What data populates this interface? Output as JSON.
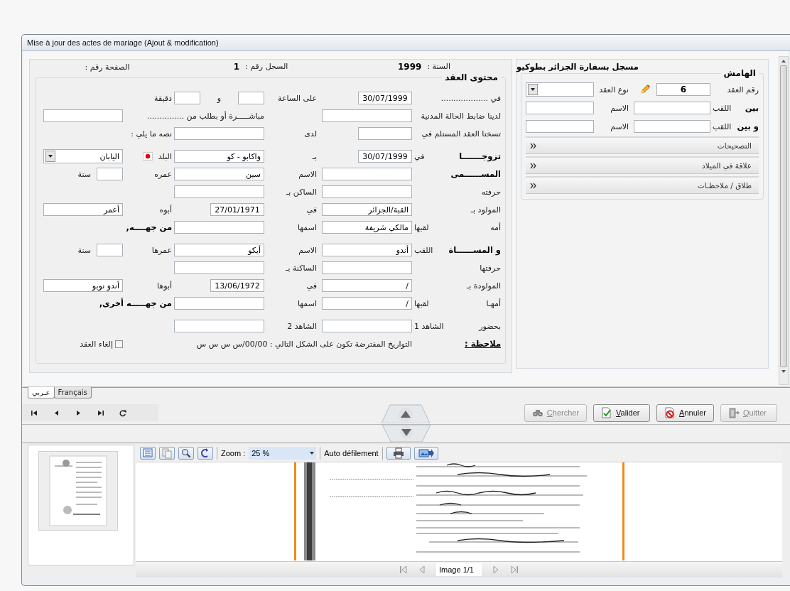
{
  "window": {
    "title": "Mise à jour des actes de mariage (Ajout & modification)"
  },
  "header": {
    "year_label": "السنة :",
    "year_value": "1999",
    "register_label": "السجل رقم :",
    "register_value": "1",
    "page_label": "الصفحة رقم :"
  },
  "contract": {
    "legend": "محتوى العقد",
    "sections": [
      [
        {
          "label_a": [
            {
              "kind": "label",
              "text": "في ..................."
            }
          ],
          "field_a": [
            {
              "kind": "short_field",
              "value": "30/07/1999"
            }
          ],
          "label_b": [
            {
              "kind": "label",
              "text": "على الساعة"
            }
          ],
          "field_b": [
            {
              "kind": "tiny_field"
            },
            {
              "kind": "label",
              "text": "و"
            },
            {
              "kind": "tiny_field"
            }
          ],
          "label_c": [
            {
              "kind": "label",
              "text": "دقيقة"
            }
          ]
        },
        {
          "label_a": [
            {
              "kind": "label",
              "text": "لدينا ضابط الحالة المدنية"
            }
          ],
          "field_a": [
            {
              "kind": "field"
            }
          ],
          "label_bc": [
            {
              "kind": "label",
              "text": "مباشـــــرة أو بطلب من ..............."
            }
          ],
          "field_c": [
            {
              "kind": "field"
            }
          ]
        },
        {
          "label_a": [
            {
              "kind": "label",
              "text": "تسختا العقد المستلم في"
            }
          ],
          "field_a": [
            {
              "kind": "short_field"
            }
          ],
          "label_b": [
            {
              "kind": "label",
              "text": "لدى"
            }
          ],
          "field_b": [
            {
              "kind": "field"
            }
          ],
          "label_c": [
            {
              "kind": "label",
              "text": "نصه ما يلي :"
            }
          ]
        }
      ],
      [
        {
          "label_a": [
            {
              "kind": "bold",
              "text": "تزوجـــــــا"
            },
            {
              "kind": "label",
              "text": "في"
            }
          ],
          "field_a": [
            {
              "kind": "short_field",
              "value": "30/07/1999"
            }
          ],
          "label_b": [
            {
              "kind": "label",
              "text": "بـ"
            }
          ],
          "field_b": [
            {
              "kind": "field",
              "value": "واكابو - كو"
            }
          ],
          "label_c": [
            {
              "kind": "label",
              "text": "البلد"
            },
            {
              "kind": "flag"
            }
          ],
          "field_c": [
            {
              "kind": "select",
              "value": "اليابان"
            }
          ]
        },
        {
          "label_a": [
            {
              "kind": "bold",
              "text": "المســــــمى"
            }
          ],
          "field_a": [
            {
              "kind": "field"
            }
          ],
          "label_b": [
            {
              "kind": "label",
              "text": "الاسم"
            }
          ],
          "field_b": [
            {
              "kind": "field",
              "value": "سين"
            }
          ],
          "label_c": [
            {
              "kind": "label",
              "text": "عمره"
            }
          ],
          "field_c": [
            {
              "kind": "tiny_field"
            },
            {
              "kind": "label",
              "text": "سنة"
            }
          ]
        },
        {
          "label_a": [
            {
              "kind": "label",
              "text": "حرفته"
            }
          ],
          "field_a": [
            {
              "kind": "field"
            }
          ],
          "label_b": [
            {
              "kind": "label",
              "text": "الساكن بـ"
            }
          ],
          "field_b": [
            {
              "kind": "field"
            }
          ]
        },
        {
          "label_a": [
            {
              "kind": "label",
              "text": "المولود بـ"
            }
          ],
          "field_a": [
            {
              "kind": "field",
              "value": "القبة/الجزائر"
            }
          ],
          "label_b": [
            {
              "kind": "label",
              "text": "في"
            }
          ],
          "field_b": [
            {
              "kind": "short_field",
              "value": "27/01/1971"
            }
          ],
          "label_c": [
            {
              "kind": "label",
              "text": "أبوه"
            }
          ],
          "field_c": [
            {
              "kind": "field",
              "value": "أعمر"
            }
          ]
        },
        {
          "label_a": [
            {
              "kind": "label",
              "text": "أمه"
            },
            {
              "kind": "label",
              "text": "لقبها"
            }
          ],
          "field_a": [
            {
              "kind": "field",
              "value": "مالكي شريفة"
            }
          ],
          "label_b": [
            {
              "kind": "label",
              "text": "اسمها"
            }
          ],
          "field_b": [
            {
              "kind": "field"
            }
          ],
          "label_c_wide": [
            {
              "kind": "bold",
              "text": "من جهــــه,"
            }
          ]
        }
      ],
      [
        {
          "label_a": [
            {
              "kind": "bold",
              "text": "و المســــــاة"
            },
            {
              "kind": "label",
              "text": "اللقب"
            }
          ],
          "field_a": [
            {
              "kind": "field",
              "value": "أندو"
            }
          ],
          "label_b": [
            {
              "kind": "label",
              "text": "الاسم"
            }
          ],
          "field_b": [
            {
              "kind": "field",
              "value": "أيكو"
            }
          ],
          "label_c": [
            {
              "kind": "label",
              "text": "عمرها"
            }
          ],
          "field_c": [
            {
              "kind": "tiny_field"
            },
            {
              "kind": "label",
              "text": "سنة"
            }
          ]
        },
        {
          "label_a": [
            {
              "kind": "label",
              "text": "حرفتها"
            }
          ],
          "field_a": [
            {
              "kind": "field"
            }
          ],
          "label_b": [
            {
              "kind": "label",
              "text": "الساكنة بـ"
            }
          ],
          "field_b": [
            {
              "kind": "field"
            }
          ]
        },
        {
          "label_a": [
            {
              "kind": "label",
              "text": "المولودة بـ"
            }
          ],
          "field_a": [
            {
              "kind": "field",
              "value": "/"
            }
          ],
          "label_b": [
            {
              "kind": "label",
              "text": "في"
            }
          ],
          "field_b": [
            {
              "kind": "short_field",
              "value": "13/06/1972"
            }
          ],
          "label_c": [
            {
              "kind": "label",
              "text": "أبوها"
            }
          ],
          "field_c": [
            {
              "kind": "field",
              "value": "أندو نوبو"
            }
          ]
        },
        {
          "label_a": [
            {
              "kind": "label",
              "text": "أمهـا"
            },
            {
              "kind": "label",
              "text": "لقبها"
            }
          ],
          "field_a": [
            {
              "kind": "field",
              "value": "/"
            }
          ],
          "label_b": [
            {
              "kind": "label",
              "text": "اسمها"
            }
          ],
          "field_b": [
            {
              "kind": "field"
            }
          ],
          "label_c_wide": [
            {
              "kind": "bold",
              "text": "من جهـــــه أخرى,"
            }
          ]
        }
      ],
      [
        {
          "label_a": [
            {
              "kind": "label",
              "text": "بحضور"
            },
            {
              "kind": "label",
              "text": "الشاهد 1"
            }
          ],
          "field_a": [
            {
              "kind": "field"
            }
          ],
          "label_b": [
            {
              "kind": "label",
              "text": "الشاهد 2"
            }
          ],
          "field_b": [
            {
              "kind": "field"
            }
          ]
        },
        {
          "label_a": [
            {
              "kind": "note_title",
              "text": "ملاحظة :"
            }
          ],
          "note": [
            {
              "kind": "note",
              "text": "التواريخ المفترضة تكون على الشكل التالي : 00/00/س س س س"
            }
          ],
          "field_c": [
            {
              "kind": "checkbox",
              "text": "إلغاء العقد",
              "checked": false
            }
          ]
        }
      ]
    ]
  },
  "side": {
    "title": "مسجل بسفارة الجزائر بطوكيو",
    "legend": "الهامش",
    "rows": [
      {
        "label_a": [
          {
            "kind": "label",
            "text": "رقم العقد"
          }
        ],
        "field_a": [
          {
            "kind": "number_field",
            "value": "6"
          },
          {
            "kind": "pencil"
          }
        ],
        "label_b": [
          {
            "kind": "label",
            "text": "نوع العقد"
          }
        ],
        "field_b": [
          {
            "kind": "select"
          }
        ]
      },
      {
        "label_a": [
          {
            "kind": "bold",
            "text": "بين"
          },
          {
            "kind": "label",
            "text": "اللقب"
          }
        ],
        "field_a": [
          {
            "kind": "field"
          }
        ],
        "label_b": [
          {
            "kind": "label",
            "text": "الاسم"
          }
        ],
        "field_b": [
          {
            "kind": "field"
          }
        ]
      },
      {
        "label_a": [
          {
            "kind": "bold",
            "text": "و بين"
          },
          {
            "kind": "label",
            "text": "اللقب"
          }
        ],
        "field_a": [
          {
            "kind": "field"
          }
        ],
        "label_b": [
          {
            "kind": "label",
            "text": "الاسم"
          }
        ],
        "field_b": [
          {
            "kind": "field"
          }
        ]
      }
    ],
    "sections": [
      {
        "label": "التصحيحات",
        "expanded": false
      },
      {
        "label": "علاقة في الميلاد",
        "expanded": false
      },
      {
        "label": "طلاق / ملاحظـات",
        "expanded": false
      }
    ]
  },
  "tabs": [
    {
      "label": "Français",
      "selected": false
    },
    {
      "label": "عـربي",
      "selected": true
    }
  ],
  "buttons": [
    {
      "label": "Quitter",
      "disabled": true
    },
    {
      "label": "Annuler",
      "disabled": false
    },
    {
      "label": "Valider",
      "disabled": false
    },
    {
      "label": "Chercher",
      "disabled": true
    }
  ],
  "viewer": {
    "zoom_label": "Zoom :",
    "zoom_value": "25 %",
    "autoscroll_label": "Auto défilement",
    "page_field": "Image 1/1"
  }
}
